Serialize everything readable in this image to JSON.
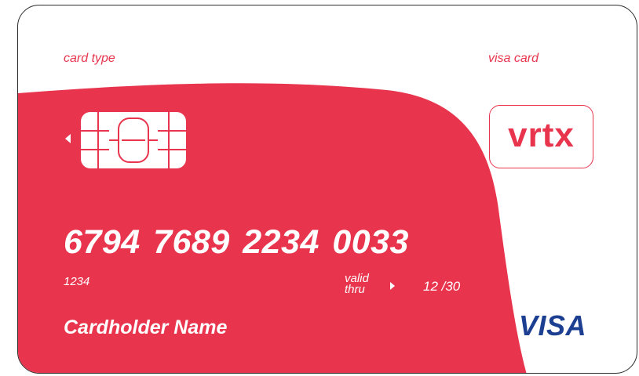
{
  "card": {
    "card_type_label": "card type",
    "visa_card_label": "visa card",
    "brand_logo_text": "vrtx",
    "card_number": "6794 7689  2234  0033",
    "small_code": "1234",
    "valid_thru_line1": "valid",
    "valid_thru_line2": "thru",
    "expiry": "12 /30",
    "cardholder_name": "Cardholder Name",
    "network_logo_text": "VISA"
  },
  "colors": {
    "accent_red": "#e8344d",
    "visa_blue": "#1d3f91",
    "border": "#2b2b2b"
  },
  "icons": {
    "chip": "chip-icon",
    "chip_arrow": "arrow-left-icon",
    "valid_arrow": "arrow-right-icon"
  }
}
